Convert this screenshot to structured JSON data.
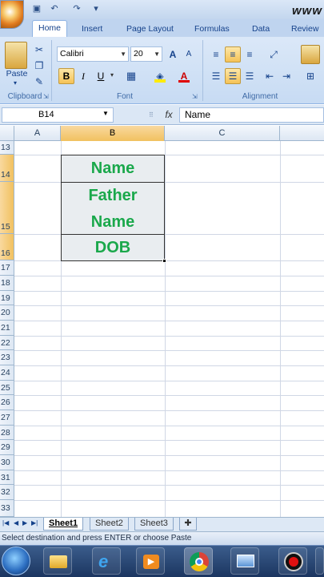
{
  "title_bar": {
    "title_text": "www",
    "qat_icons": [
      "save-icon",
      "undo-icon",
      "redo-icon",
      "customize-qat-icon"
    ]
  },
  "tabs": [
    "Home",
    "Insert",
    "Page Layout",
    "Formulas",
    "Data",
    "Review"
  ],
  "active_tab": "Home",
  "ribbon": {
    "clipboard": {
      "paste_label": "Paste",
      "group_label": "Clipboard"
    },
    "font": {
      "font_name": "Calibri",
      "font_size": "20",
      "bold": "B",
      "italic": "I",
      "underline": "U",
      "grow": "A",
      "shrink": "A",
      "font_color_letter": "A",
      "group_label": "Font"
    },
    "alignment": {
      "group_label": "Alignment"
    }
  },
  "formula_bar": {
    "name_box": "B14",
    "fx": "fx",
    "formula": "Name"
  },
  "columns": [
    {
      "label": "A",
      "selected": false
    },
    {
      "label": "B",
      "selected": true
    },
    {
      "label": "C",
      "selected": false
    }
  ],
  "rows": [
    "13",
    "14",
    "15",
    "16",
    "17",
    "18",
    "19",
    "20",
    "21",
    "22",
    "23",
    "24",
    "25",
    "26",
    "27",
    "28",
    "29",
    "30",
    "31",
    "32",
    "33"
  ],
  "cells": {
    "b14": "Name",
    "b15_line1": "Father",
    "b15_line2": "Name",
    "b16": "DOB"
  },
  "sheets": [
    "Sheet1",
    "Sheet2",
    "Sheet3"
  ],
  "active_sheet": "Sheet1",
  "status_text": "Select destination and press ENTER or choose Paste",
  "taskbar_icons": [
    "start-orb-icon",
    "file-explorer-icon",
    "internet-explorer-icon",
    "media-player-icon",
    "chrome-icon",
    "network-icon",
    "record-icon"
  ],
  "colors": {
    "cell_text": "#1aa84b",
    "cell_fill": "#e9edf0",
    "selected_header": "#f1c15f",
    "ribbon": "#c7dbf3"
  }
}
